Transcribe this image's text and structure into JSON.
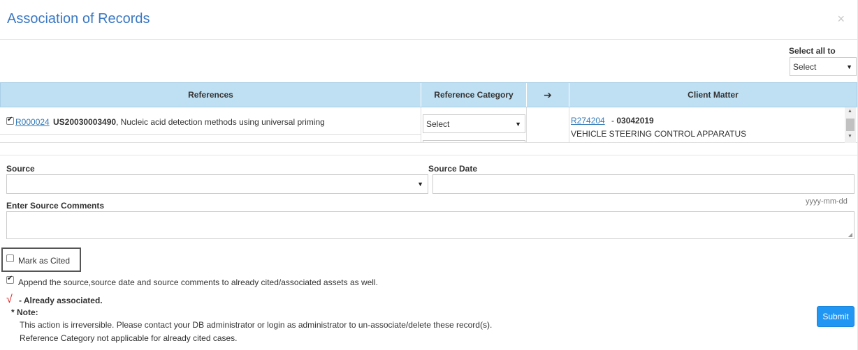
{
  "dialog": {
    "title": "Association of Records",
    "close_glyph": "×"
  },
  "select_all": {
    "label": "Select all to",
    "value": "Select"
  },
  "table": {
    "headers": {
      "references": "References",
      "reference_category": "Reference Category",
      "arrow": "➔",
      "client_matter": "Client Matter"
    },
    "rows": [
      {
        "checked": true,
        "ref_id": "R000024",
        "ref_number": "US20030003490",
        "ref_desc": ", Nucleic acid detection methods using universal priming",
        "category": "Select",
        "client_id": "R274204",
        "client_sep": " - ",
        "client_number": "03042019",
        "client_desc": "VEHICLE STEERING CONTROL APPARATUS"
      }
    ]
  },
  "form": {
    "source_label": "Source",
    "source_value": "",
    "source_date_label": "Source Date",
    "source_date_value": "",
    "date_hint": "yyyy-mm-dd",
    "comments_label": "Enter Source Comments",
    "comments_value": ""
  },
  "options": {
    "mark_cited": {
      "label": "Mark as Cited",
      "checked": false
    },
    "append": {
      "label": "Append the source,source date and source comments to already cited/associated assets as well.",
      "checked": true
    }
  },
  "legend": {
    "symbol": "√",
    "text": "- Already associated."
  },
  "note": {
    "label": "* Note:",
    "lines": [
      "This action is irreversible. Please contact your DB administrator or login as administrator to un-associate/delete these record(s).",
      "Reference Category not applicable for already cited cases."
    ]
  },
  "submit_label": "Submit",
  "colors": {
    "title": "#3a78c3",
    "header_bg": "#bfdff2",
    "submit_bg": "#2196f3",
    "check_red": "#dd2222"
  }
}
